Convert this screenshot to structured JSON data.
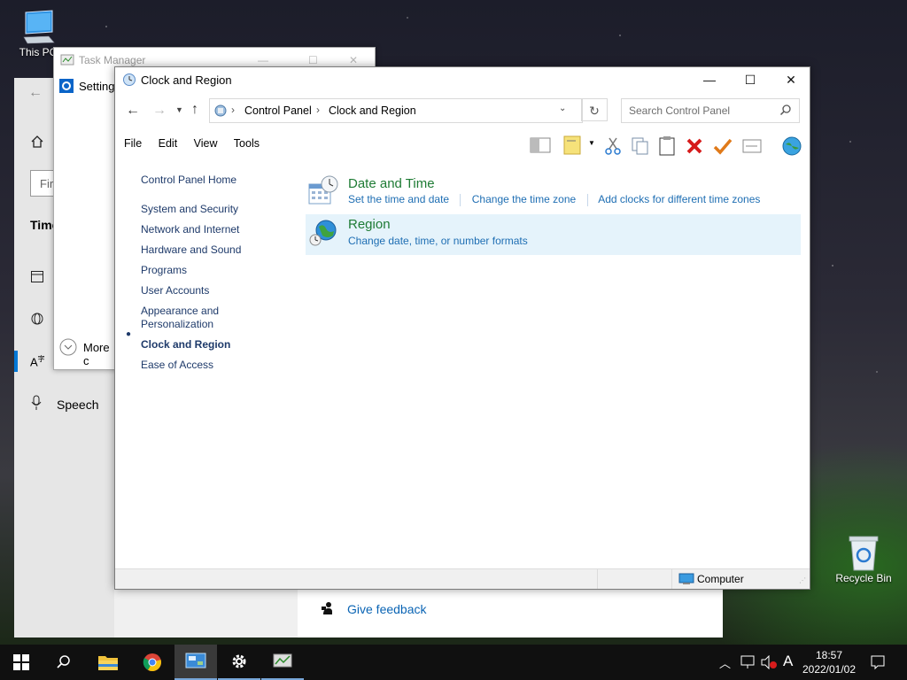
{
  "desktop": {
    "this_pc_label": "This PC",
    "recycle_bin_label": "Recycle Bin"
  },
  "settings_window": {
    "title": "Settings",
    "search_placeholder_partial": "Fir",
    "section_partial": "Time",
    "speech_label": "Speech",
    "more_partial": "More c",
    "give_feedback": "Give feedback"
  },
  "task_manager": {
    "title": "Task Manager"
  },
  "control_panel": {
    "title": "Clock and Region",
    "breadcrumb": [
      "Control Panel",
      "Clock and Region"
    ],
    "search_placeholder": "Search Control Panel",
    "menu": [
      "File",
      "Edit",
      "View",
      "Tools"
    ],
    "nav": {
      "home": "Control Panel Home",
      "items": [
        "System and Security",
        "Network and Internet",
        "Hardware and Sound",
        "Programs",
        "User Accounts",
        "Appearance and Personalization",
        "Clock and Region",
        "Ease of Access"
      ],
      "current": "Clock and Region"
    },
    "categories": [
      {
        "title": "Date and Time",
        "links": [
          "Set the time and date",
          "Change the time zone",
          "Add clocks for different time zones"
        ]
      },
      {
        "title": "Region",
        "links": [
          "Change date, time, or number formats"
        ]
      }
    ],
    "status_text": "Computer"
  },
  "taskbar": {
    "time": "18:57",
    "date": "2022/01/02",
    "ime": "A"
  },
  "colors": {
    "accent_blue": "#1e6eb3",
    "category_green": "#1e7b34",
    "hover_highlight": "#e5f3fb"
  }
}
